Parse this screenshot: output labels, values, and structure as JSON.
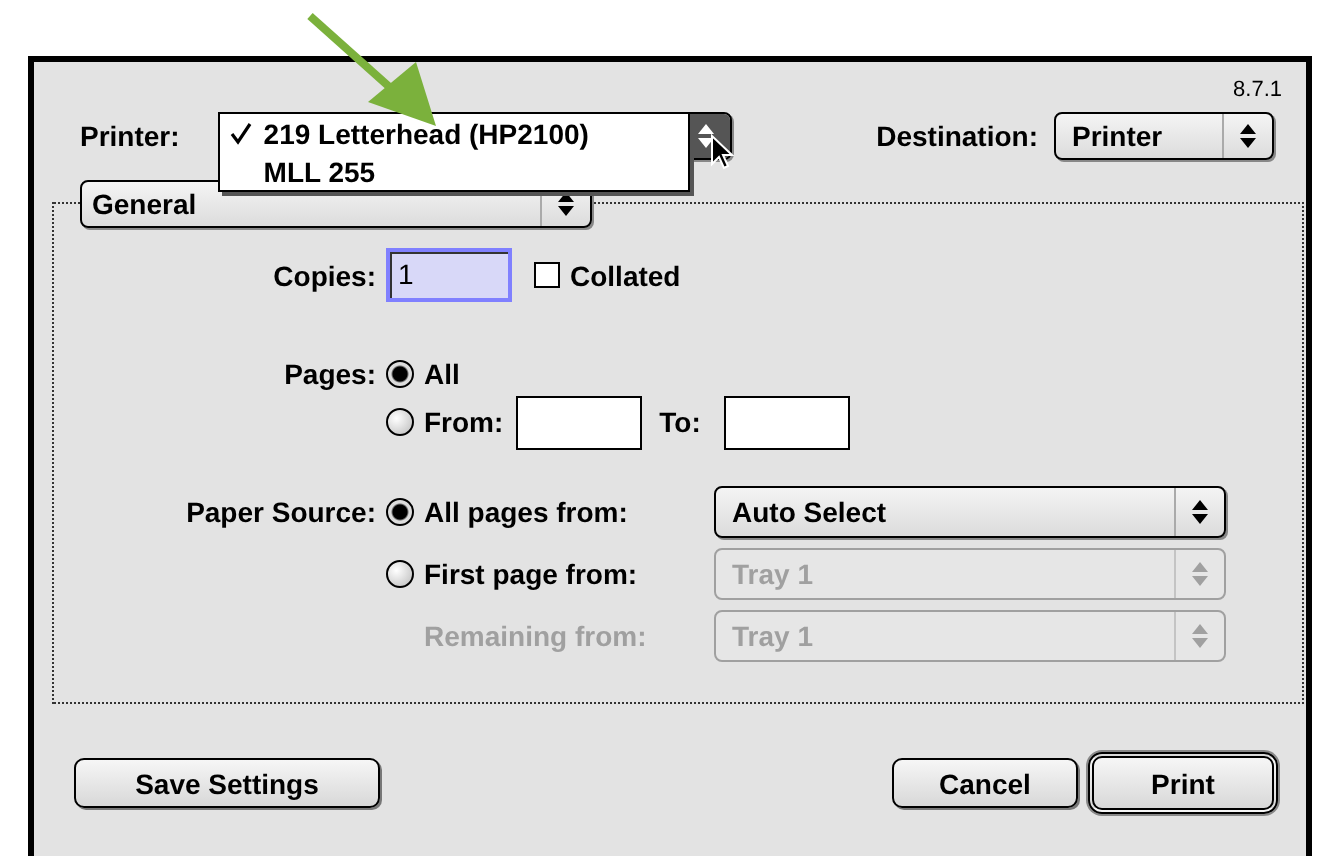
{
  "version": "8.7.1",
  "printer": {
    "label": "Printer:",
    "expanded": true,
    "options": [
      {
        "label": "219 Letterhead (HP2100)",
        "selected": true
      },
      {
        "label": "MLL 255",
        "selected": false
      }
    ]
  },
  "destination": {
    "label": "Destination:",
    "value": "Printer"
  },
  "panel_menu": {
    "value": "General"
  },
  "copies": {
    "label": "Copies:",
    "value": "1",
    "focused": true
  },
  "collated": {
    "label": "Collated",
    "checked": false
  },
  "pages": {
    "label": "Pages:",
    "options": [
      {
        "label": "All",
        "selected": true
      },
      {
        "label": "From:",
        "selected": false
      }
    ],
    "to_label": "To:"
  },
  "paper_source": {
    "label": "Paper Source:",
    "rows": [
      {
        "kind": "radio",
        "label": "All pages from:",
        "selected": true,
        "value": "Auto Select",
        "disabled": false
      },
      {
        "kind": "radio",
        "label": "First page from:",
        "selected": false,
        "value": "Tray 1",
        "disabled": true
      },
      {
        "kind": "plain",
        "label": "Remaining from:",
        "value": "Tray 1",
        "disabled": true
      }
    ]
  },
  "buttons_left": [
    {
      "label": "Save Settings",
      "default": false
    }
  ],
  "buttons_right": [
    {
      "label": "Cancel",
      "default": false
    },
    {
      "label": "Print",
      "default": true
    }
  ]
}
